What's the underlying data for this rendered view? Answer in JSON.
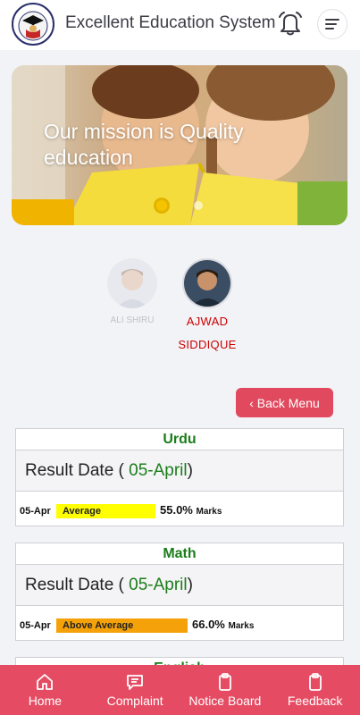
{
  "header": {
    "title": "Excellent Education System",
    "logo": "school-crest-logo",
    "bell_icon": "bell-icon",
    "menu_icon": "menu-lines-icon"
  },
  "banner": {
    "caption": "Our mission is Quality education",
    "slide_count": 2,
    "active_slide": 1
  },
  "students": [
    {
      "name": "ALI SHIRU",
      "selected": false
    },
    {
      "name": "AJWAD SIDDIQUE",
      "selected": true
    }
  ],
  "back_button": {
    "label": "‹ Back Menu"
  },
  "results": [
    {
      "subject": "Urdu",
      "result_date_label": "Result Date (",
      "result_date": "05-April",
      "result_date_close": ")",
      "short_date": "05-Apr",
      "grade": "Average",
      "grade_color": "#ffff00",
      "bar_fraction": 0.5,
      "percent": "55.0%",
      "marks_label": "Marks"
    },
    {
      "subject": "Math",
      "result_date_label": "Result Date (",
      "result_date": "05-April",
      "result_date_close": ")",
      "short_date": "05-Apr",
      "grade": "Above Average",
      "grade_color": "#f5a20a",
      "bar_fraction": 0.66,
      "percent": "66.0%",
      "marks_label": "Marks"
    },
    {
      "subject": "English"
    }
  ],
  "nav": [
    {
      "label": "Home",
      "icon": "home-icon"
    },
    {
      "label": "Complaint",
      "icon": "chat-icon"
    },
    {
      "label": "Notice Board",
      "icon": "clipboard-icon"
    },
    {
      "label": "Feedback",
      "icon": "clipboard-icon"
    }
  ],
  "colors": {
    "accent": "#e54c63",
    "subject_green": "#1a7d1a",
    "student_name_red": "#cc0000"
  }
}
